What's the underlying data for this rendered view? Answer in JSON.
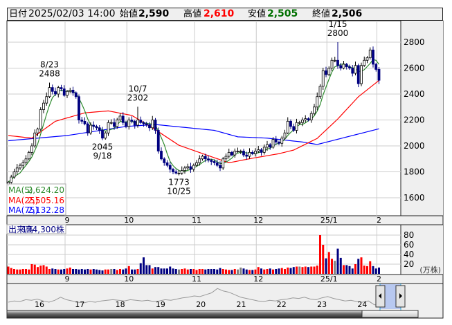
{
  "header": {
    "date_label": "日付",
    "date_value": "2025/02/03 14:00",
    "open_label": "始値",
    "open_value": "2,590",
    "high_label": "高値",
    "high_value": "2,610",
    "low_label": "安値",
    "low_value": "2,505",
    "close_label": "終値",
    "close_value": "2,506"
  },
  "colors": {
    "up_body": "#ffffff",
    "down_body": "#000080",
    "up_volume": "#ff0000",
    "down_volume": "#000080",
    "flat_volume": "#808080",
    "ma5": "#2e8b2e",
    "ma25": "#ff0000",
    "ma75": "#0000ff",
    "high": "#ff0000",
    "low": "#007000"
  },
  "legend": [
    {
      "label": "MA(5)",
      "value": "2,624.20"
    },
    {
      "label": "MA(25)",
      "value": "2,505.16"
    },
    {
      "label": "MA(75)",
      "value": "2,132.28"
    }
  ],
  "volume_legend": {
    "label": "出来高",
    "value": "134,300株"
  },
  "chart_data": {
    "type": "candlestick",
    "ylim": [
      1500,
      2900
    ],
    "y_ticks": [
      "2800",
      "2600",
      "2400",
      "2200",
      "2000",
      "1800",
      "1600"
    ],
    "y_tick_values": [
      2800,
      2600,
      2400,
      2200,
      2000,
      1800,
      1600
    ],
    "month_labels": [
      {
        "label": "9",
        "index": 20
      },
      {
        "label": "10",
        "index": 41
      },
      {
        "label": "11",
        "index": 64
      },
      {
        "label": "12",
        "index": 85
      },
      {
        "label": "25/1",
        "index": 109
      },
      {
        "label": "2",
        "index": 126
      }
    ],
    "first_open": 1700,
    "close": [
      1720,
      1760,
      1800,
      1830,
      1850,
      1870,
      1900,
      1950,
      2000,
      2100,
      2130,
      2280,
      2330,
      2380,
      2450,
      2420,
      2400,
      2450,
      2440,
      2390,
      2420,
      2430,
      2410,
      2380,
      2200,
      2190,
      2170,
      2100,
      2160,
      2150,
      2140,
      2120,
      2060,
      2100,
      2180,
      2180,
      2150,
      2200,
      2230,
      2180,
      2150,
      2200,
      2190,
      2160,
      2200,
      2180,
      2170,
      2160,
      2140,
      2200,
      2120,
      1960,
      1900,
      1870,
      1850,
      1820,
      1800,
      1790,
      1790,
      1810,
      1830,
      1840,
      1820,
      1850,
      1870,
      1900,
      1920,
      1900,
      1890,
      1880,
      1870,
      1850,
      1830,
      1900,
      1920,
      1950,
      1930,
      1960,
      1960,
      1960,
      1930,
      1920,
      1950,
      1940,
      1960,
      1970,
      1950,
      1990,
      2010,
      1990,
      2050,
      2030,
      2020,
      2060,
      2100,
      2190,
      2150,
      2120,
      2180,
      2180,
      2200,
      2210,
      2200,
      2250,
      2300,
      2380,
      2460,
      2580,
      2550,
      2600,
      2660,
      2660,
      2620,
      2600,
      2630,
      2610,
      2600,
      2560,
      2620,
      2480,
      2620,
      2660,
      2680,
      2740,
      2630,
      2590,
      2506
    ],
    "ma25_points": [
      [
        0,
        2080
      ],
      [
        8,
        2060
      ],
      [
        16,
        2190
      ],
      [
        26,
        2255
      ],
      [
        34,
        2270
      ],
      [
        42,
        2235
      ],
      [
        49,
        2140
      ],
      [
        58,
        2005
      ],
      [
        68,
        1925
      ],
      [
        75,
        1870
      ],
      [
        83,
        1905
      ],
      [
        92,
        1940
      ],
      [
        97,
        1968
      ],
      [
        105,
        2058
      ],
      [
        112,
        2208
      ],
      [
        119,
        2379
      ],
      [
        126,
        2505
      ]
    ],
    "ma75_points": [
      [
        0,
        2040
      ],
      [
        20,
        2080
      ],
      [
        40,
        2150
      ],
      [
        50,
        2165
      ],
      [
        70,
        2120
      ],
      [
        78,
        2070
      ],
      [
        88,
        2060
      ],
      [
        100,
        2030
      ],
      [
        105,
        2011
      ],
      [
        126,
        2132
      ]
    ],
    "annotations": [
      {
        "index": 14,
        "date": "8/23",
        "price": "2488",
        "value": 2488,
        "type": "high"
      },
      {
        "index": 44,
        "date": "10/7",
        "price": "2302",
        "value": 2302,
        "type": "high"
      },
      {
        "index": 112,
        "date": "1/15",
        "price": "2800",
        "value": 2800,
        "type": "high"
      },
      {
        "index": 32,
        "date": "9/18",
        "price": "2045",
        "value": 2045,
        "type": "low"
      },
      {
        "index": 58,
        "date": "10/25",
        "price": "1773",
        "value": 1773,
        "type": "low"
      }
    ],
    "volume": {
      "unit": "(万株)",
      "y_ticks": [
        "80",
        "60",
        "40",
        "20"
      ],
      "y_tick_values": [
        80,
        60,
        40,
        20
      ],
      "values": [
        15,
        12,
        10,
        9,
        9,
        10,
        10,
        9,
        20,
        19,
        14,
        17,
        18,
        15,
        10,
        11,
        10,
        9,
        9,
        10,
        11,
        13,
        10,
        10,
        9,
        10,
        9,
        10,
        9,
        10,
        9,
        8,
        7,
        9,
        9,
        10,
        10,
        8,
        10,
        9,
        11,
        16,
        9,
        9,
        10,
        22,
        34,
        18,
        18,
        11,
        14,
        14,
        11,
        11,
        11,
        15,
        11,
        10,
        9,
        10,
        11,
        9,
        10,
        10,
        8,
        10,
        10,
        9,
        10,
        10,
        10,
        9,
        12,
        10,
        9,
        8,
        8,
        10,
        9,
        13,
        11,
        9,
        8,
        8,
        9,
        14,
        11,
        9,
        10,
        11,
        9,
        10,
        11,
        12,
        10,
        13,
        12,
        14,
        15,
        15,
        14,
        15,
        14,
        15,
        15,
        17,
        80,
        60,
        32,
        45,
        31,
        27,
        52,
        33,
        18,
        18,
        16,
        11,
        20,
        31,
        34,
        17,
        16,
        26,
        16,
        11,
        13
      ]
    }
  },
  "navigator": {
    "year_labels": [
      "16",
      "17",
      "18",
      "19",
      "20",
      "21",
      "22",
      "23",
      "24"
    ],
    "series": [
      40,
      42,
      41,
      44,
      43,
      45,
      42,
      40,
      43,
      48,
      44,
      42,
      40,
      39,
      41,
      40,
      42,
      43,
      44,
      43,
      42,
      44,
      43,
      42,
      43,
      41,
      42,
      44,
      43,
      45,
      47,
      48,
      50,
      49,
      52,
      55,
      62,
      58,
      56,
      52,
      48,
      46,
      44,
      42,
      41,
      43,
      42,
      44,
      45,
      47,
      46,
      48,
      45,
      44,
      47,
      49,
      46,
      44,
      42,
      43,
      41,
      40,
      42,
      36,
      35
    ]
  }
}
